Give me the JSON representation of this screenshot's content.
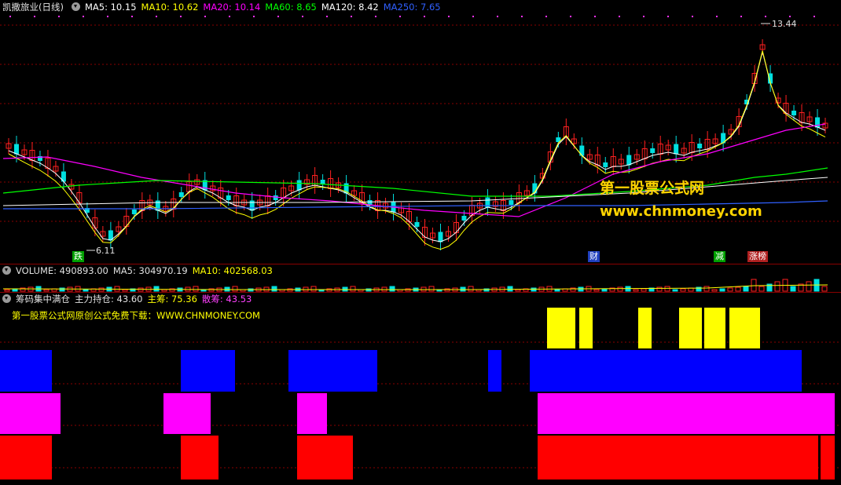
{
  "main_panel": {
    "title": "凯撒旅业(日线)",
    "indicators": [
      {
        "label": "MA5: 10.15",
        "color": "#ffffff"
      },
      {
        "label": "MA10: 10.62",
        "color": "#ffff00"
      },
      {
        "label": "MA20: 10.14",
        "color": "#ff00ff"
      },
      {
        "label": "MA60: 8.65",
        "color": "#00ff00"
      },
      {
        "label": "MA120: 8.42",
        "color": "#ffffff"
      },
      {
        "label": "MA250: 7.65",
        "color": "#3060ff"
      }
    ],
    "high_label": "13.44",
    "low_label": "6.11",
    "markers": [
      {
        "text": "跌",
        "bg": "#00a000"
      },
      {
        "text": "财",
        "bg": "#2040c0"
      },
      {
        "text": "减",
        "bg": "#00a000"
      },
      {
        "text": "涨榜",
        "bg": "#b02020"
      }
    ],
    "watermark_cn": "第一股票公式网",
    "watermark_url": "www.chnmoney.com"
  },
  "volume_panel": {
    "title": "VOLUME: 490893.00",
    "ma5": "MA5: 304970.19",
    "ma10": "MA10: 402568.03"
  },
  "indicator_panel": {
    "title": "筹码集中满仓",
    "main_hold": "主力持仓: 43.60",
    "main_chip": "主筹: 75.36",
    "scatter_chip": "散筹: 43.53",
    "note": "第一股票公式网原创公式免费下载：WWW.CHNMONEY.COM"
  },
  "colors": {
    "up": "#ff2020",
    "down": "#00e0e0",
    "grid": "#8a0000",
    "yellow": "#ffff00",
    "blue": "#0000ff",
    "magenta": "#ff00ff",
    "red": "#ff0000"
  }
}
